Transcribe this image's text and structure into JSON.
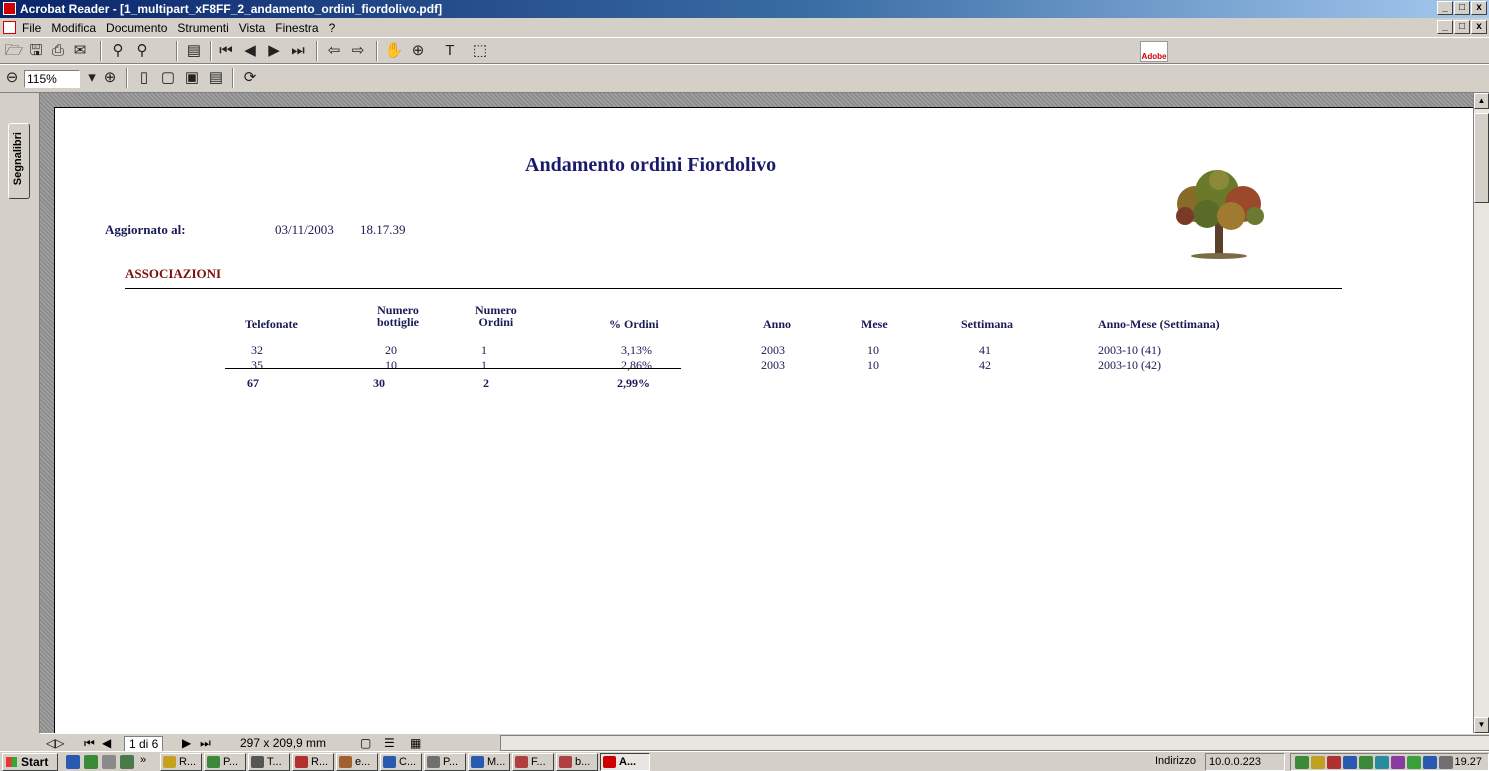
{
  "window": {
    "title": "Acrobat Reader - [1_multipart_xF8FF_2_andamento_ordini_fiordolivo.pdf]",
    "controls": [
      "_",
      "□",
      "x"
    ]
  },
  "menu": {
    "items": [
      "File",
      "Modifica",
      "Documento",
      "Strumenti",
      "Vista",
      "Finestra",
      "?"
    ]
  },
  "toolbar": {
    "zoom_value": "115%",
    "adobe_logo": "Adobe"
  },
  "sidebar": {
    "tab_label": "Segnalibri"
  },
  "document": {
    "title": "Andamento ordini Fiordolivo",
    "updated_label": "Aggiornato al:",
    "updated_date": "03/11/2003",
    "updated_time": "18.17.39",
    "section": "ASSOCIAZIONI",
    "table": {
      "headers": {
        "telefonate": "Telefonate",
        "bottiglie_1": "Numero",
        "bottiglie_2": "bottiglie",
        "ordini_1": "Numero",
        "ordini_2": "Ordini",
        "perc": "% Ordini",
        "anno": "Anno",
        "mese": "Mese",
        "settimana": "Settimana",
        "annomese": "Anno-Mese (Settimana)"
      },
      "rows": [
        {
          "telefonate": "32",
          "bottiglie": "20",
          "ordini": "1",
          "perc": "3,13%",
          "anno": "2003",
          "mese": "10",
          "settimana": "41",
          "annomese": "2003-10 (41)"
        },
        {
          "telefonate": "35",
          "bottiglie": "10",
          "ordini": "1",
          "perc": "2,86%",
          "anno": "2003",
          "mese": "10",
          "settimana": "42",
          "annomese": "2003-10 (42)"
        }
      ],
      "totals": {
        "telefonate": "67",
        "bottiglie": "30",
        "ordini": "2",
        "perc": "2,99%"
      }
    }
  },
  "status": {
    "page": "1 di 6",
    "page_size": "297 x 209,9 mm"
  },
  "taskbar": {
    "start": "Start",
    "buttons": [
      "R...",
      "P...",
      "T...",
      "R...",
      "e...",
      "C...",
      "P...",
      "M...",
      "F...",
      "b...",
      "A..."
    ],
    "address_label": "Indirizzo",
    "address_value": "10.0.0.223",
    "clock": "19.27"
  }
}
